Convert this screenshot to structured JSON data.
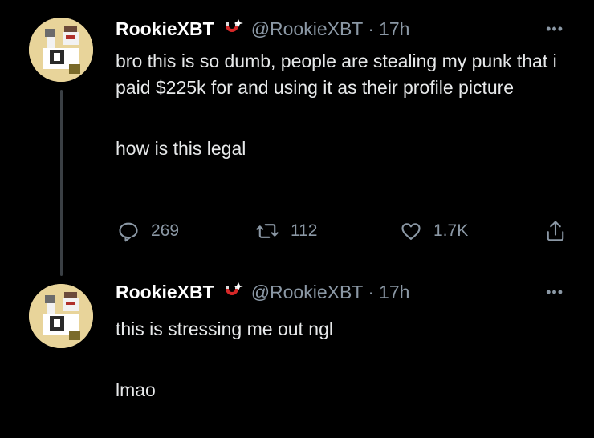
{
  "colors": {
    "background": "#000000",
    "text": "#e7e9ea",
    "muted": "#8b98a5",
    "thread_line": "#3a3f44",
    "avatar_bg": "#e8d49a"
  },
  "tweets": [
    {
      "name": "RookieXBT",
      "badge_icon": "magnet-icon",
      "handle": "@RookieXBT",
      "separator": "·",
      "time": "17h",
      "more": "•••",
      "paragraphs": [
        "bro this is so dumb, people are stealing my punk that i paid $225k for and using it as their profile picture",
        "how is this legal"
      ],
      "actions": {
        "reply_count": "269",
        "retweet_count": "112",
        "like_count": "1.7K"
      }
    },
    {
      "name": "RookieXBT",
      "badge_icon": "magnet-icon",
      "handle": "@RookieXBT",
      "separator": "·",
      "time": "17h",
      "more": "•••",
      "paragraphs": [
        "this is stressing me out ngl",
        "lmao"
      ]
    }
  ]
}
